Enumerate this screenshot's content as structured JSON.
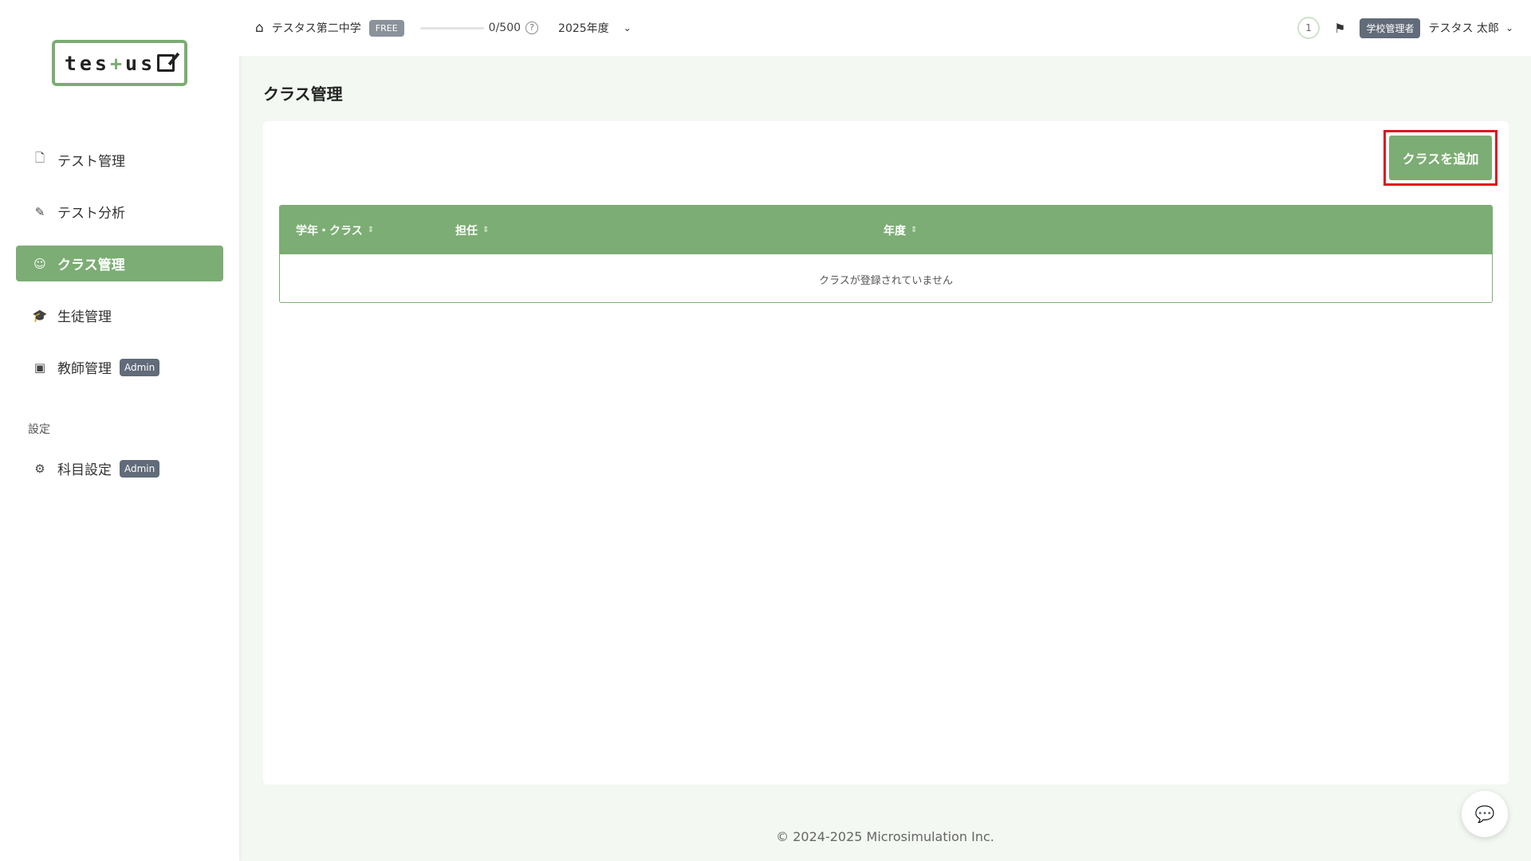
{
  "logo": {
    "text_pre": "tes",
    "text_plus": "+",
    "text_post": "us"
  },
  "sidebar": {
    "items": [
      {
        "label": "テスト管理",
        "icon": "document-icon"
      },
      {
        "label": "テスト分析",
        "icon": "chart-pen-icon"
      },
      {
        "label": "クラス管理",
        "icon": "users-icon",
        "active": true
      },
      {
        "label": "生徒管理",
        "icon": "graduation-cap-icon"
      },
      {
        "label": "教師管理",
        "icon": "teacher-icon",
        "badge": "Admin"
      }
    ],
    "section_label": "設定",
    "settings_items": [
      {
        "label": "科目設定",
        "icon": "gear-icon",
        "badge": "Admin"
      }
    ]
  },
  "header": {
    "school_name": "テスタス第二中学",
    "plan_badge": "FREE",
    "quota_text": "0/500",
    "quota_progress": 0,
    "help_glyph": "?",
    "year": "2025年度",
    "notification_count": "1",
    "role_badge": "学校管理者",
    "user_name": "テスタス 太郎"
  },
  "main": {
    "page_title": "クラス管理",
    "add_button": "クラスを追加",
    "table": {
      "columns": [
        "学年・クラス",
        "担任",
        "年度"
      ],
      "empty_message": "クラスが登録されていません"
    }
  },
  "footer": {
    "copyright": "© 2024-2025 Microsimulation Inc."
  },
  "colors": {
    "accent": "#7cad74",
    "highlight": "#e0141b",
    "admin_badge": "#616b79"
  }
}
